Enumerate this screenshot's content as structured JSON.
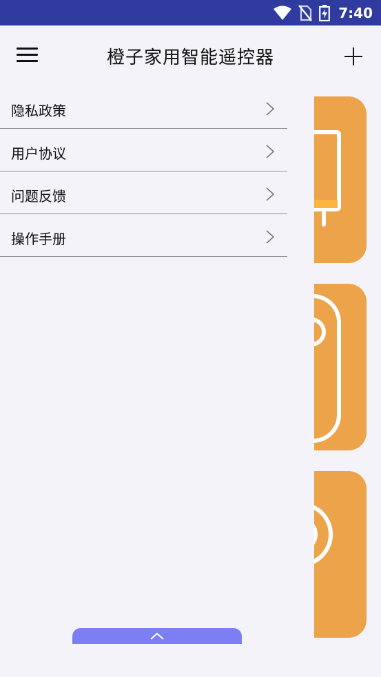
{
  "status_bar": {
    "time": "7:40",
    "icons": [
      "wifi-icon",
      "no-sim-icon",
      "battery-charging-icon"
    ]
  },
  "header": {
    "title": "橙子家用智能遥控器",
    "menu_icon": "hamburger-menu-icon",
    "add_icon": "plus-icon"
  },
  "drawer": {
    "items": [
      {
        "label": "隐私政策"
      },
      {
        "label": "用户协议"
      },
      {
        "label": "问题反馈"
      },
      {
        "label": "操作手册"
      }
    ]
  },
  "device_cards": {
    "accent_color": "#eca349",
    "icons": [
      "tv-icon",
      "remote-icon",
      "fan-icon"
    ]
  },
  "bottom": {
    "handle_icon": "chevron-up-icon",
    "color": "#7c7ff3"
  },
  "colors": {
    "status_bar": "#2f3b9e",
    "background": "#f3f3f9"
  }
}
